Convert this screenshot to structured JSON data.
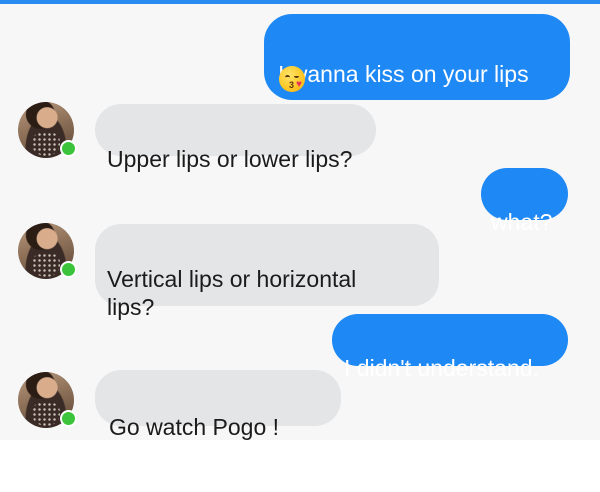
{
  "messages": [
    {
      "side": "out",
      "text": "I wanna kiss on your lips",
      "emoji": "kissing-face-icon"
    },
    {
      "side": "in",
      "text": "Upper lips or lower lips?"
    },
    {
      "side": "out",
      "text": "what?"
    },
    {
      "side": "in",
      "text": "Vertical lips or horizontal\nlips?"
    },
    {
      "side": "out",
      "text": "I didn't understand."
    },
    {
      "side": "in",
      "text": "Go watch Pogo !"
    }
  ],
  "colors": {
    "outgoing_bubble": "#1e88f5",
    "incoming_bubble": "#e4e5e7",
    "online_indicator": "#3bc43b",
    "top_bar": "#2a8cf0"
  }
}
